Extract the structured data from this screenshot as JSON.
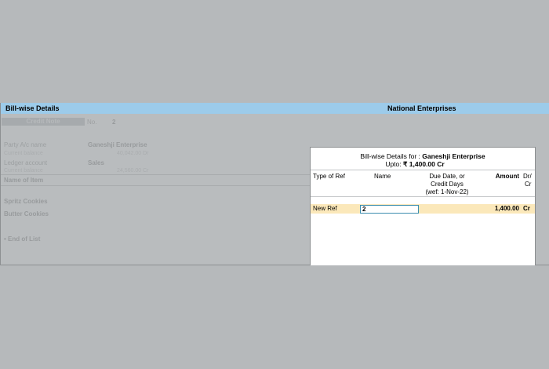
{
  "titlebar": {
    "left": "Bill-wise Details",
    "right": "National Enterprises"
  },
  "background": {
    "voucher_type": "Credit Note",
    "no_label": "No.",
    "no_value": "2",
    "party_label": "Party A/c name",
    "party_value": "Ganeshji Enterprise",
    "party_balance_label": "Current balance",
    "party_balance_value": "40,042.00 Dr",
    "ledger_label": "Ledger account",
    "ledger_value": "Sales",
    "ledger_balance_label": "Current balance",
    "ledger_balance_value": "24,560.00 Cr",
    "item_header": "Name of Item",
    "items": [
      "Spritz Cookies",
      "Butter Cookies"
    ],
    "end_of_list": "• End of List"
  },
  "popup": {
    "title_prefix": "Bill-wise Details for :",
    "party": "Ganeshji Enterprise",
    "upto_label": "Upto:",
    "upto_value": "₹ 1,400.00 Cr",
    "columns": {
      "type": "Type of Ref",
      "name": "Name",
      "due_line1": "Due Date, or",
      "due_line2": "Credit Days",
      "due_line3": "(wef: 1-Nov-22)",
      "amount": "Amount",
      "drcr_line1": "Dr/",
      "drcr_line2": "Cr"
    },
    "row": {
      "type": "New Ref",
      "name": "2",
      "amount": "1,400.00",
      "drcr": "Cr"
    }
  },
  "colors": {
    "titlebar": "#9ccbea",
    "highlight_row": "#fbe8ba",
    "input_border": "#3c8dae"
  }
}
